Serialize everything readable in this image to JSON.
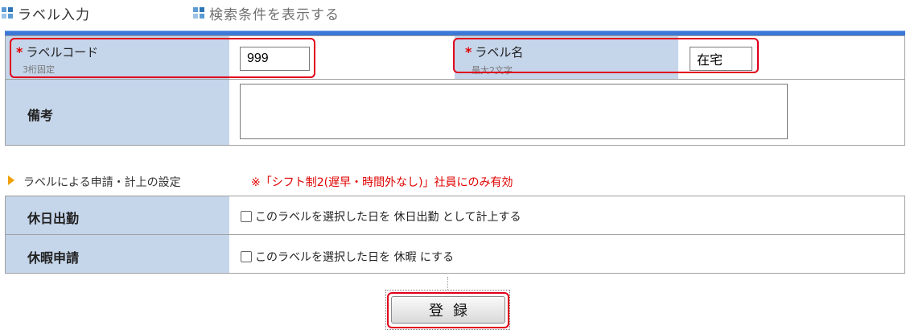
{
  "tabs": {
    "input": "ラベル入力",
    "search": "検索条件を表示する"
  },
  "form": {
    "label_code": {
      "required_mark": "*",
      "label": "ラベルコード",
      "hint": "3桁固定",
      "value": "999"
    },
    "label_name": {
      "required_mark": "*",
      "label": "ラベル名",
      "hint": "最大2文字",
      "value": "在宅"
    },
    "remarks": {
      "label": "備考",
      "value": ""
    }
  },
  "settings": {
    "title": "ラベルによる申請・計上の設定",
    "note": "※「シフト制2(遅早・時間外なし)」社員にのみ有効",
    "rows": [
      {
        "label": "休日出勤",
        "option_text": "このラベルを選択した日を 休日出勤 として計上する"
      },
      {
        "label": "休暇申請",
        "option_text": "このラベルを選択した日を 休暇 にする"
      }
    ]
  },
  "actions": {
    "register": "登録"
  }
}
